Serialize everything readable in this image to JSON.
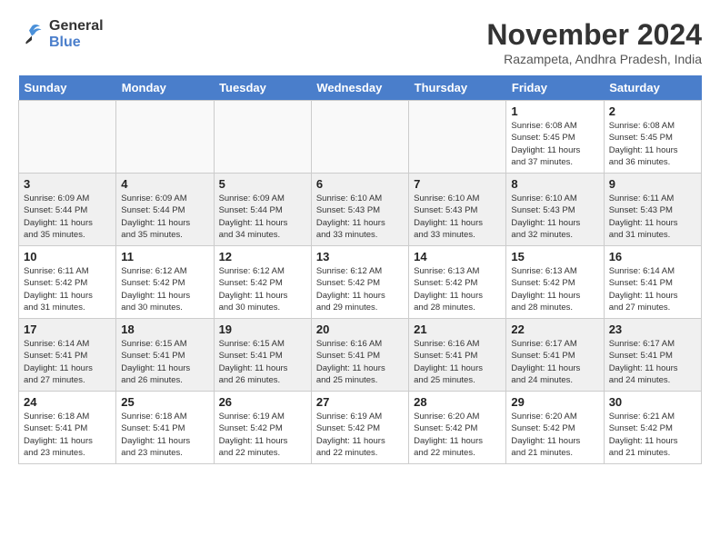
{
  "header": {
    "logo_line1": "General",
    "logo_line2": "Blue",
    "month_title": "November 2024",
    "location": "Razampeta, Andhra Pradesh, India"
  },
  "days_of_week": [
    "Sunday",
    "Monday",
    "Tuesday",
    "Wednesday",
    "Thursday",
    "Friday",
    "Saturday"
  ],
  "weeks": [
    [
      {
        "day": "",
        "info": "",
        "empty": true
      },
      {
        "day": "",
        "info": "",
        "empty": true
      },
      {
        "day": "",
        "info": "",
        "empty": true
      },
      {
        "day": "",
        "info": "",
        "empty": true
      },
      {
        "day": "",
        "info": "",
        "empty": true
      },
      {
        "day": "1",
        "info": "Sunrise: 6:08 AM\nSunset: 5:45 PM\nDaylight: 11 hours\nand 37 minutes."
      },
      {
        "day": "2",
        "info": "Sunrise: 6:08 AM\nSunset: 5:45 PM\nDaylight: 11 hours\nand 36 minutes."
      }
    ],
    [
      {
        "day": "3",
        "info": "Sunrise: 6:09 AM\nSunset: 5:44 PM\nDaylight: 11 hours\nand 35 minutes."
      },
      {
        "day": "4",
        "info": "Sunrise: 6:09 AM\nSunset: 5:44 PM\nDaylight: 11 hours\nand 35 minutes."
      },
      {
        "day": "5",
        "info": "Sunrise: 6:09 AM\nSunset: 5:44 PM\nDaylight: 11 hours\nand 34 minutes."
      },
      {
        "day": "6",
        "info": "Sunrise: 6:10 AM\nSunset: 5:43 PM\nDaylight: 11 hours\nand 33 minutes."
      },
      {
        "day": "7",
        "info": "Sunrise: 6:10 AM\nSunset: 5:43 PM\nDaylight: 11 hours\nand 33 minutes."
      },
      {
        "day": "8",
        "info": "Sunrise: 6:10 AM\nSunset: 5:43 PM\nDaylight: 11 hours\nand 32 minutes."
      },
      {
        "day": "9",
        "info": "Sunrise: 6:11 AM\nSunset: 5:43 PM\nDaylight: 11 hours\nand 31 minutes."
      }
    ],
    [
      {
        "day": "10",
        "info": "Sunrise: 6:11 AM\nSunset: 5:42 PM\nDaylight: 11 hours\nand 31 minutes."
      },
      {
        "day": "11",
        "info": "Sunrise: 6:12 AM\nSunset: 5:42 PM\nDaylight: 11 hours\nand 30 minutes."
      },
      {
        "day": "12",
        "info": "Sunrise: 6:12 AM\nSunset: 5:42 PM\nDaylight: 11 hours\nand 30 minutes."
      },
      {
        "day": "13",
        "info": "Sunrise: 6:12 AM\nSunset: 5:42 PM\nDaylight: 11 hours\nand 29 minutes."
      },
      {
        "day": "14",
        "info": "Sunrise: 6:13 AM\nSunset: 5:42 PM\nDaylight: 11 hours\nand 28 minutes."
      },
      {
        "day": "15",
        "info": "Sunrise: 6:13 AM\nSunset: 5:42 PM\nDaylight: 11 hours\nand 28 minutes."
      },
      {
        "day": "16",
        "info": "Sunrise: 6:14 AM\nSunset: 5:41 PM\nDaylight: 11 hours\nand 27 minutes."
      }
    ],
    [
      {
        "day": "17",
        "info": "Sunrise: 6:14 AM\nSunset: 5:41 PM\nDaylight: 11 hours\nand 27 minutes."
      },
      {
        "day": "18",
        "info": "Sunrise: 6:15 AM\nSunset: 5:41 PM\nDaylight: 11 hours\nand 26 minutes."
      },
      {
        "day": "19",
        "info": "Sunrise: 6:15 AM\nSunset: 5:41 PM\nDaylight: 11 hours\nand 26 minutes."
      },
      {
        "day": "20",
        "info": "Sunrise: 6:16 AM\nSunset: 5:41 PM\nDaylight: 11 hours\nand 25 minutes."
      },
      {
        "day": "21",
        "info": "Sunrise: 6:16 AM\nSunset: 5:41 PM\nDaylight: 11 hours\nand 25 minutes."
      },
      {
        "day": "22",
        "info": "Sunrise: 6:17 AM\nSunset: 5:41 PM\nDaylight: 11 hours\nand 24 minutes."
      },
      {
        "day": "23",
        "info": "Sunrise: 6:17 AM\nSunset: 5:41 PM\nDaylight: 11 hours\nand 24 minutes."
      }
    ],
    [
      {
        "day": "24",
        "info": "Sunrise: 6:18 AM\nSunset: 5:41 PM\nDaylight: 11 hours\nand 23 minutes."
      },
      {
        "day": "25",
        "info": "Sunrise: 6:18 AM\nSunset: 5:41 PM\nDaylight: 11 hours\nand 23 minutes."
      },
      {
        "day": "26",
        "info": "Sunrise: 6:19 AM\nSunset: 5:42 PM\nDaylight: 11 hours\nand 22 minutes."
      },
      {
        "day": "27",
        "info": "Sunrise: 6:19 AM\nSunset: 5:42 PM\nDaylight: 11 hours\nand 22 minutes."
      },
      {
        "day": "28",
        "info": "Sunrise: 6:20 AM\nSunset: 5:42 PM\nDaylight: 11 hours\nand 22 minutes."
      },
      {
        "day": "29",
        "info": "Sunrise: 6:20 AM\nSunset: 5:42 PM\nDaylight: 11 hours\nand 21 minutes."
      },
      {
        "day": "30",
        "info": "Sunrise: 6:21 AM\nSunset: 5:42 PM\nDaylight: 11 hours\nand 21 minutes."
      }
    ]
  ]
}
